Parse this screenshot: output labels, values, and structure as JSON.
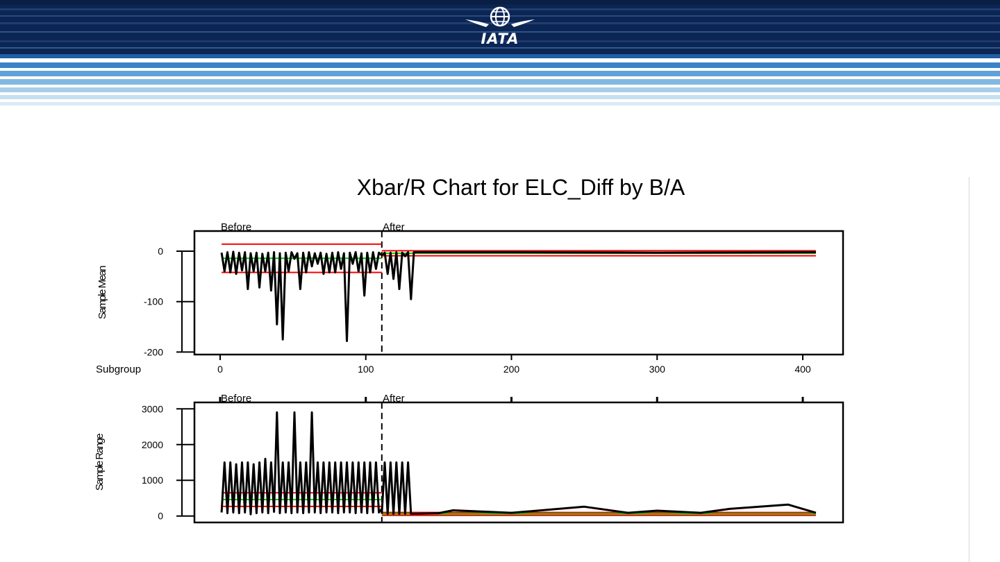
{
  "brand": {
    "logo_text": "IATA"
  },
  "chart_data": {
    "title": "Xbar/R Chart for ELC_Diff by B/A",
    "type": "line",
    "phase_split": 111,
    "phase_labels": [
      "Before",
      "After"
    ],
    "x_label": "Subgroup",
    "x_ticks": [
      0,
      100,
      200,
      300,
      400
    ],
    "xlim": [
      -3,
      428
    ],
    "colors": {
      "data": "#000000",
      "limits": "#ff0000",
      "center": "#00cc00"
    },
    "panels": [
      {
        "name": "xbar",
        "ylabel": "Sample Mean",
        "ylim": [
          -205,
          40
        ],
        "y_ticks": [
          0,
          -100,
          -200
        ],
        "before": {
          "ucl": 14,
          "center": -14,
          "lcl": -42,
          "x": [
            1,
            3,
            5,
            7,
            9,
            11,
            13,
            15,
            17,
            19,
            21,
            23,
            25,
            27,
            29,
            31,
            33,
            35,
            37,
            39,
            41,
            43,
            45,
            47,
            49,
            51,
            53,
            55,
            57,
            59,
            61,
            63,
            65,
            67,
            69,
            71,
            73,
            75,
            77,
            79,
            81,
            83,
            85,
            87,
            89,
            91,
            93,
            95,
            97,
            99,
            101,
            103,
            105,
            107,
            109,
            111
          ],
          "y": [
            -3,
            -40,
            -2,
            -42,
            -1,
            -45,
            -3,
            -38,
            -2,
            -75,
            -4,
            -40,
            -3,
            -72,
            -5,
            -40,
            -3,
            -78,
            -2,
            -145,
            -4,
            -175,
            -3,
            -40,
            -2,
            -15,
            -4,
            -75,
            -3,
            -42,
            -2,
            -30,
            -4,
            -25,
            -3,
            -45,
            -5,
            -42,
            -3,
            -42,
            -2,
            -35,
            -4,
            -178,
            -3,
            -25,
            -2,
            -40,
            -4,
            -88,
            -3,
            -42,
            -2,
            -35,
            -3,
            -8
          ]
        },
        "after": {
          "ucl": 1,
          "center": -4,
          "lcl": -9,
          "x": [
            111,
            113,
            115,
            117,
            119,
            121,
            123,
            125,
            127,
            129,
            131,
            133,
            200,
            300,
            409
          ],
          "y": [
            -8,
            -3,
            -45,
            -3,
            -55,
            -2,
            -75,
            -3,
            -10,
            -2,
            -95,
            -2,
            -2,
            -3,
            -2
          ]
        }
      },
      {
        "name": "range",
        "ylabel": "Sample Range",
        "ylim": [
          -180,
          3180
        ],
        "y_ticks": [
          0,
          1000,
          2000,
          3000
        ],
        "before": {
          "ucl": 650,
          "center": 460,
          "lcl": 270,
          "x": [
            1,
            3,
            5,
            7,
            9,
            11,
            13,
            15,
            17,
            19,
            21,
            23,
            25,
            27,
            29,
            31,
            33,
            35,
            37,
            39,
            41,
            43,
            45,
            47,
            49,
            51,
            53,
            55,
            57,
            59,
            61,
            63,
            65,
            67,
            69,
            71,
            73,
            75,
            77,
            79,
            81,
            83,
            85,
            87,
            89,
            91,
            93,
            95,
            97,
            99,
            101,
            103,
            105,
            107,
            109,
            111
          ],
          "y": [
            100,
            1500,
            80,
            1500,
            100,
            1450,
            80,
            1500,
            100,
            1500,
            50,
            1450,
            80,
            1500,
            100,
            1600,
            80,
            1500,
            120,
            2900,
            80,
            1500,
            100,
            1500,
            80,
            2900,
            100,
            1500,
            80,
            1500,
            100,
            2900,
            100,
            1500,
            80,
            1500,
            100,
            1500,
            100,
            1500,
            80,
            1500,
            100,
            1500,
            100,
            1500,
            80,
            1500,
            100,
            1500,
            80,
            1500,
            100,
            1500,
            100,
            200
          ]
        },
        "after": {
          "ucl": 100,
          "center": 60,
          "lcl": 20,
          "x": [
            111,
            113,
            115,
            117,
            119,
            121,
            123,
            125,
            127,
            129,
            131,
            150,
            160,
            200,
            250,
            280,
            300,
            330,
            350,
            390,
            409
          ],
          "y": [
            60,
            1500,
            60,
            1500,
            60,
            1500,
            60,
            1500,
            60,
            1500,
            60,
            80,
            160,
            90,
            260,
            90,
            150,
            90,
            200,
            320,
            90
          ]
        }
      }
    ]
  }
}
